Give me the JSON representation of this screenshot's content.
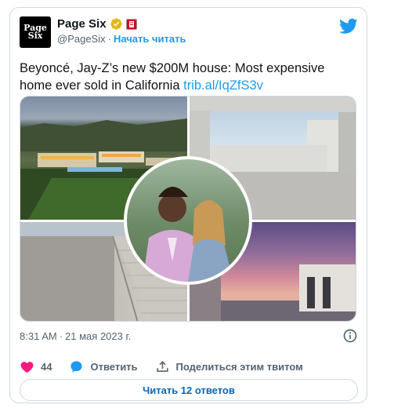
{
  "account": {
    "name": "Page Six",
    "avatar_text_line1": "Page",
    "avatar_text_line2": "Six",
    "handle": "@PageSix",
    "separator": "·",
    "follow_label": "Начать читать"
  },
  "tweet": {
    "text": "Beyoncé, Jay-Z’s new $200M house: Most expensive home ever sold in California",
    "link": "trib.al/IqZfS3v",
    "time": "8:31 AM",
    "meta_separator": "·",
    "date": "21 мая 2023 г."
  },
  "actions": {
    "like_count": "44",
    "reply_label": "Ответить",
    "share_label": "Поделиться этим твитом"
  },
  "footer": {
    "read_replies_label": "Читать 12 ответов"
  },
  "colors": {
    "accent": "#1d9bf0",
    "like": "#f91880",
    "muted": "#536471",
    "border": "#cfd9de",
    "gold_badge": "#e2b719"
  }
}
